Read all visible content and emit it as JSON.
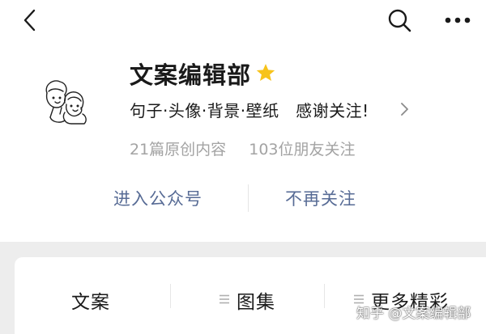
{
  "topbar": {
    "back_icon": "chevron-left-icon",
    "search_icon": "search-icon",
    "more_icon": "more-dots-icon"
  },
  "account": {
    "name": "文案编辑部",
    "badge_icon": "star-icon",
    "badge_color": "#f7c31b",
    "bio": "句子·头像·背景·壁纸　感谢关注!",
    "stats": [
      "21篇原创内容",
      "103位朋友关注"
    ]
  },
  "actions": {
    "follow_label": "进入公众号",
    "unfollow_label": "不再关注"
  },
  "menu": {
    "items": [
      {
        "label": "文案"
      },
      {
        "label": "图集"
      },
      {
        "label": "更多精彩"
      }
    ]
  },
  "watermark": "知乎 @文案编辑部",
  "colors": {
    "link": "#576b95",
    "muted": "#a3a3a3",
    "background": "#ededed"
  }
}
